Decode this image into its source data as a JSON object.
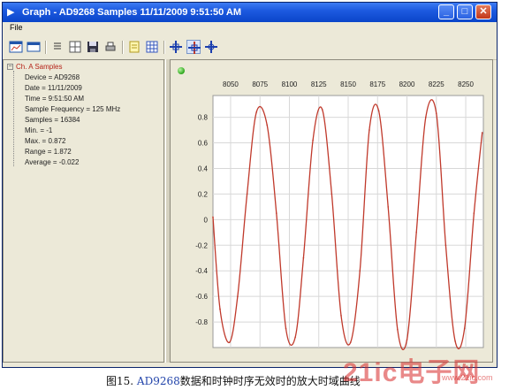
{
  "window": {
    "title": "Graph - AD9268 Samples 11/11/2009 9:51:50 AM",
    "minimize_glyph": "_",
    "maximize_glyph": "□",
    "close_glyph": "✕"
  },
  "menu": {
    "file_label": "File"
  },
  "toolbar_icons": [
    "new-graph-icon",
    "window-icon",
    "list-icon",
    "split-icon",
    "save-icon",
    "print-icon",
    "note-icon",
    "grid-icon",
    "crosshair-icon",
    "crosshair-pressed-icon",
    "crosshair-alt-icon"
  ],
  "tree": {
    "root_label": "Ch. A Samples",
    "expander": "−",
    "items": [
      "Device = AD9268",
      "Date = 11/11/2009",
      "Time = 9:51:50 AM",
      "Sample Frequency = 125 MHz",
      "Samples = 16384",
      "Min. = -1",
      "Max. = 0.872",
      "Range = 1.872",
      "Average = -0.022"
    ]
  },
  "colors": {
    "trace": "#c0392b",
    "plot_bg": "#ffffff",
    "grid": "#d8d8d8",
    "status_led": "#2ca51b"
  },
  "chart_data": {
    "type": "line",
    "x_ticks": [
      8050,
      8075,
      8100,
      8125,
      8150,
      8175,
      8200,
      8225,
      8250
    ],
    "y_ticks": [
      0.8,
      0.6,
      0.4,
      0.2,
      0,
      -0.2,
      -0.4,
      -0.6,
      -0.8
    ],
    "xlim": [
      8035,
      8265
    ],
    "ylim": [
      -1,
      0.97
    ],
    "grid": true,
    "series": [
      {
        "x": [
          8035,
          8041,
          8049,
          8056,
          8064,
          8072,
          8081,
          8089,
          8097,
          8105,
          8112,
          8120,
          8128,
          8136,
          8144,
          8152,
          8160,
          8168,
          8176,
          8184,
          8192,
          8200,
          8208,
          8216,
          8225,
          8233,
          8241,
          8249,
          8257,
          8264
        ],
        "y": [
          0.02,
          -0.7,
          -0.96,
          -0.6,
          0.2,
          0.84,
          0.74,
          0.05,
          -0.85,
          -0.92,
          -0.3,
          0.62,
          0.86,
          0.2,
          -0.75,
          -0.96,
          -0.4,
          0.7,
          0.85,
          0.1,
          -0.86,
          -0.94,
          -0.1,
          0.8,
          0.83,
          -0.2,
          -0.95,
          -0.85,
          0.05,
          0.68
        ]
      }
    ]
  },
  "caption": {
    "figure": "图15.",
    "part": "AD9268",
    "text": "数据和时钟时序无效时的放大时域曲线"
  },
  "watermark": {
    "main": "21ic电子网",
    "url": "www.21ic.com"
  }
}
